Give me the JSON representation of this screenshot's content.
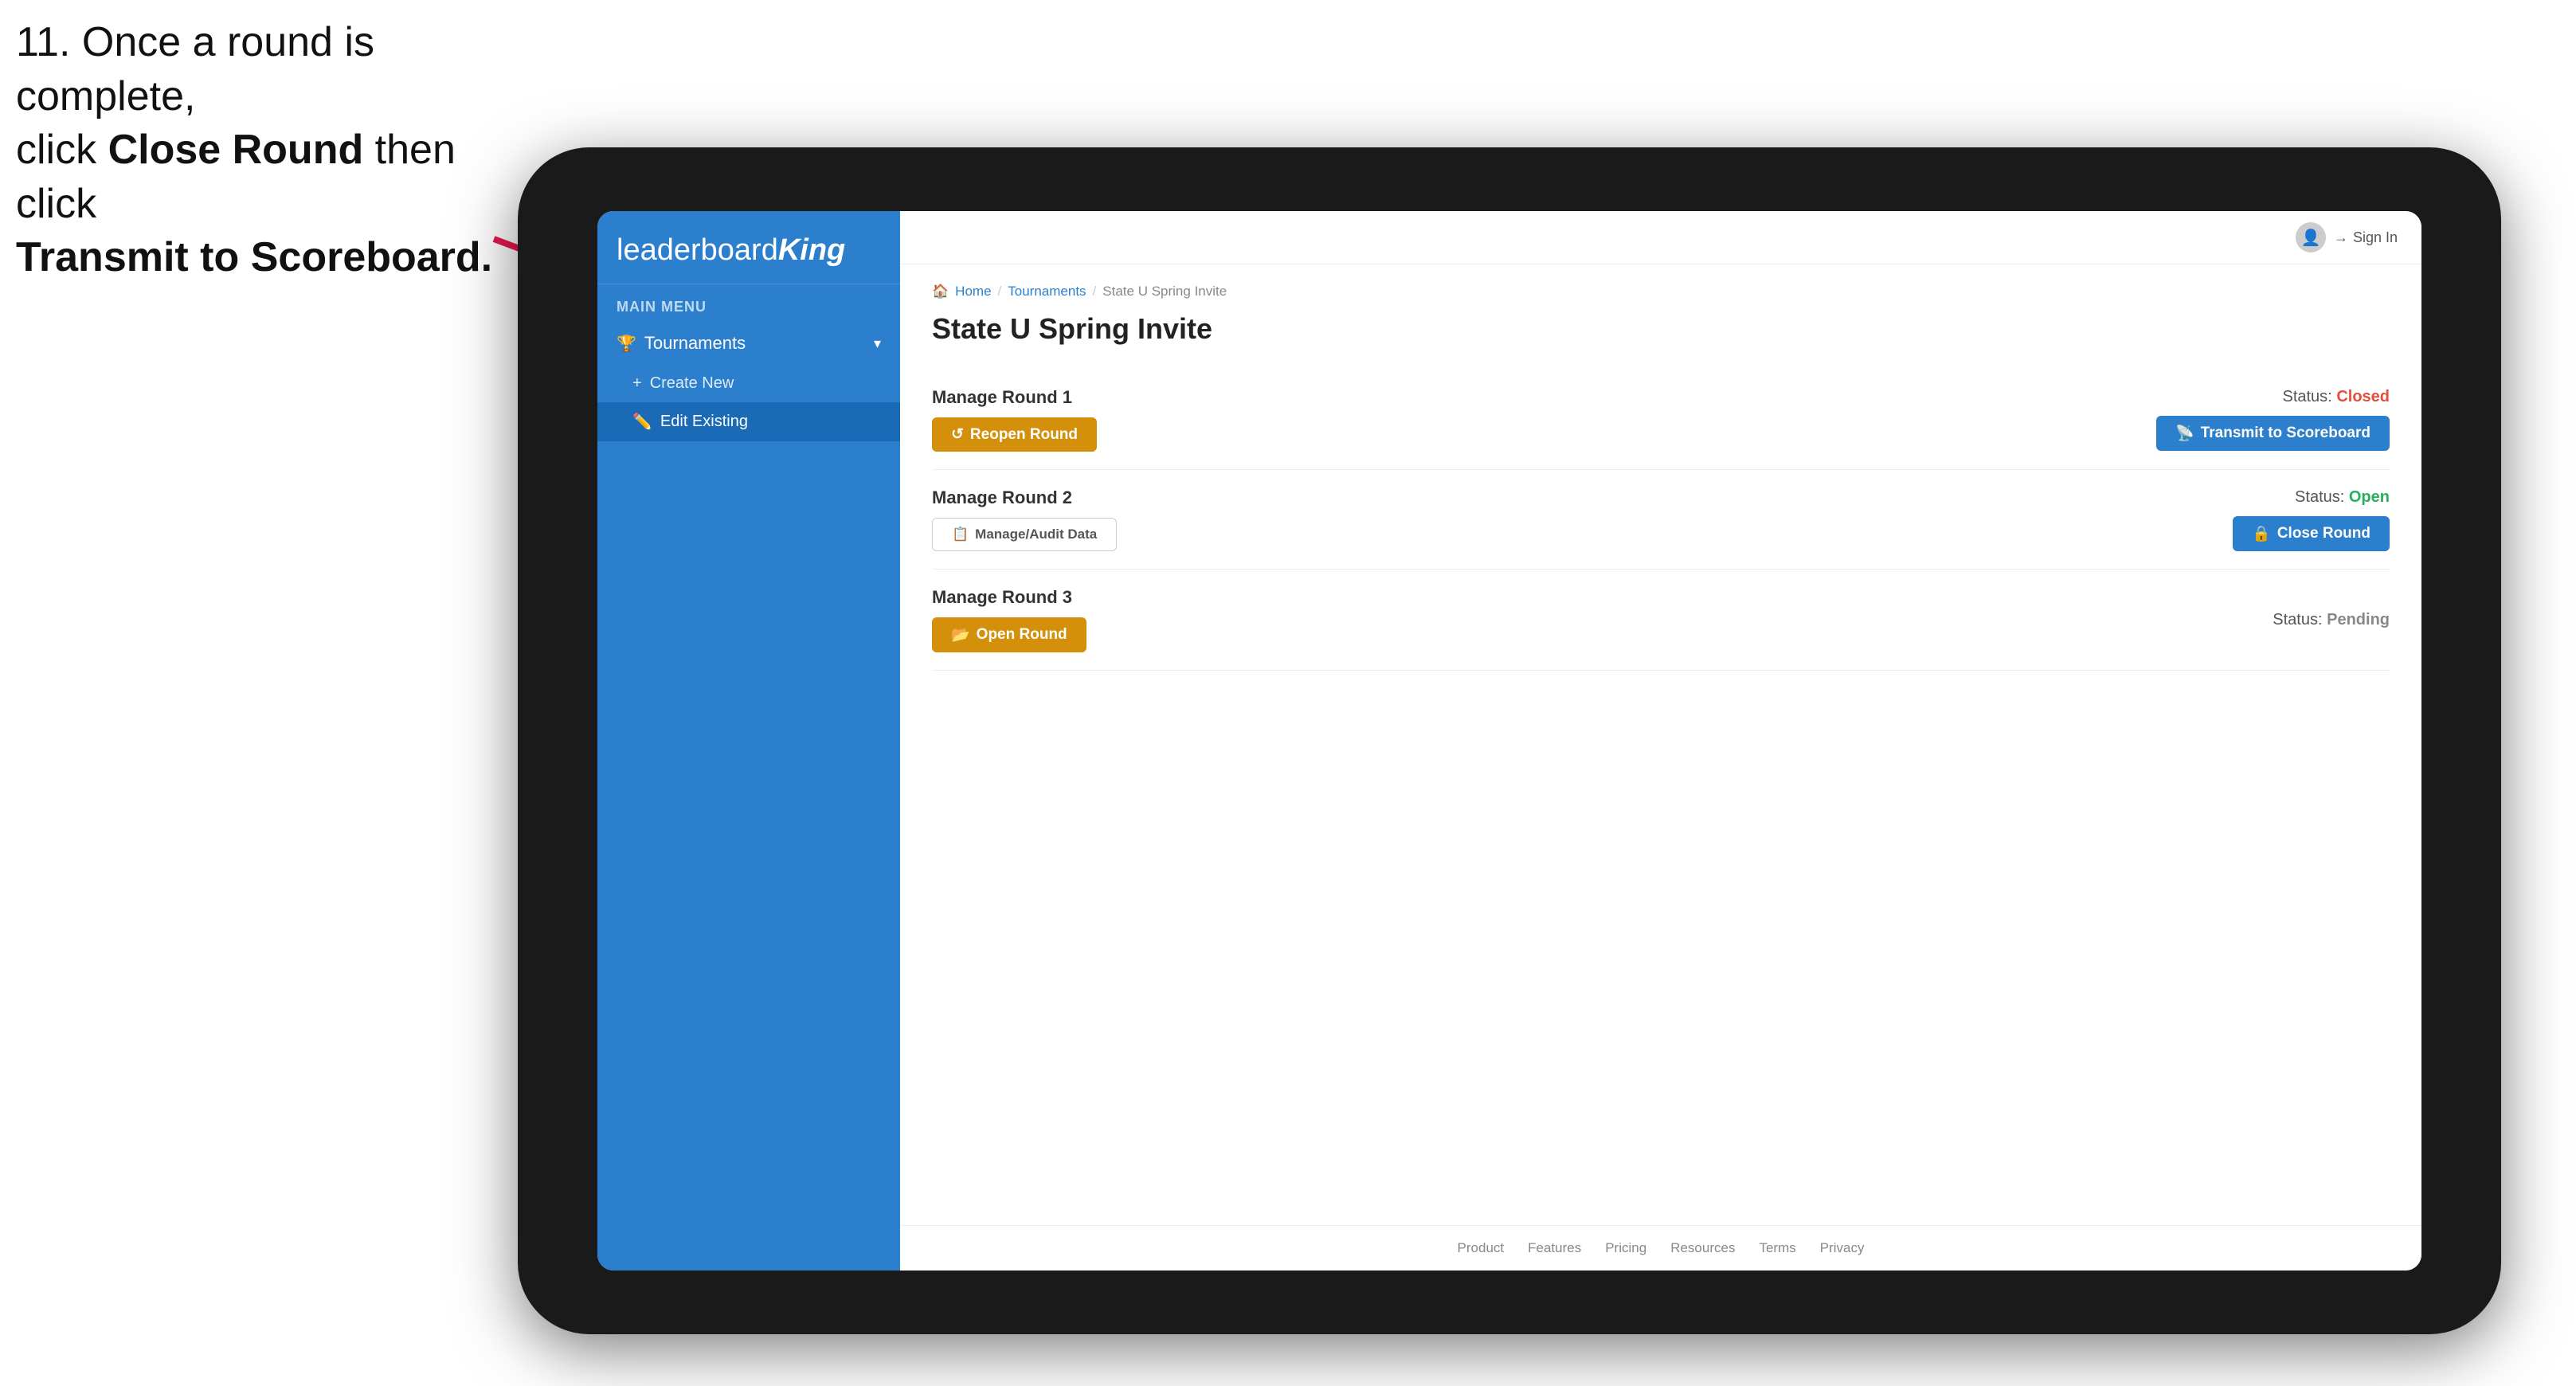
{
  "instruction": {
    "line1": "11. Once a round is complete,",
    "line2": "click ",
    "bold1": "Close Round",
    "line3": " then click",
    "bold2": "Transmit to Scoreboard."
  },
  "logo": {
    "text": "leaderboard",
    "king": "King"
  },
  "sidebar": {
    "main_menu_label": "MAIN MENU",
    "nav_items": [
      {
        "label": "Tournaments",
        "icon": "🏆",
        "has_chevron": true
      }
    ],
    "sub_items": [
      {
        "label": "Create New",
        "icon": "+",
        "active": false
      },
      {
        "label": "Edit Existing",
        "icon": "✏️",
        "active": true
      }
    ]
  },
  "topbar": {
    "sign_in": "Sign In"
  },
  "breadcrumb": {
    "home": "Home",
    "tournaments": "Tournaments",
    "current": "State U Spring Invite"
  },
  "page": {
    "title": "State U Spring Invite",
    "rounds": [
      {
        "id": 1,
        "manage_label": "Manage Round 1",
        "status_label": "Status:",
        "status_value": "Closed",
        "status_class": "status-closed",
        "btn_left_label": "Reopen Round",
        "btn_right_label": "Transmit to Scoreboard",
        "btn_left_type": "gold",
        "btn_right_type": "blue",
        "has_middle_btn": false
      },
      {
        "id": 2,
        "manage_label": "Manage Round 2",
        "status_label": "Status:",
        "status_value": "Open",
        "status_class": "status-open",
        "btn_left_label": "Manage/Audit Data",
        "btn_right_label": "Close Round",
        "btn_left_type": "outline",
        "btn_right_type": "blue",
        "has_middle_btn": false
      },
      {
        "id": 3,
        "manage_label": "Manage Round 3",
        "status_label": "Status:",
        "status_value": "Pending",
        "status_class": "status-pending",
        "btn_left_label": "Open Round",
        "btn_right_label": "",
        "btn_left_type": "gold",
        "btn_right_type": "",
        "has_middle_btn": false
      }
    ]
  },
  "footer": {
    "links": [
      "Product",
      "Features",
      "Pricing",
      "Resources",
      "Terms",
      "Privacy"
    ]
  }
}
